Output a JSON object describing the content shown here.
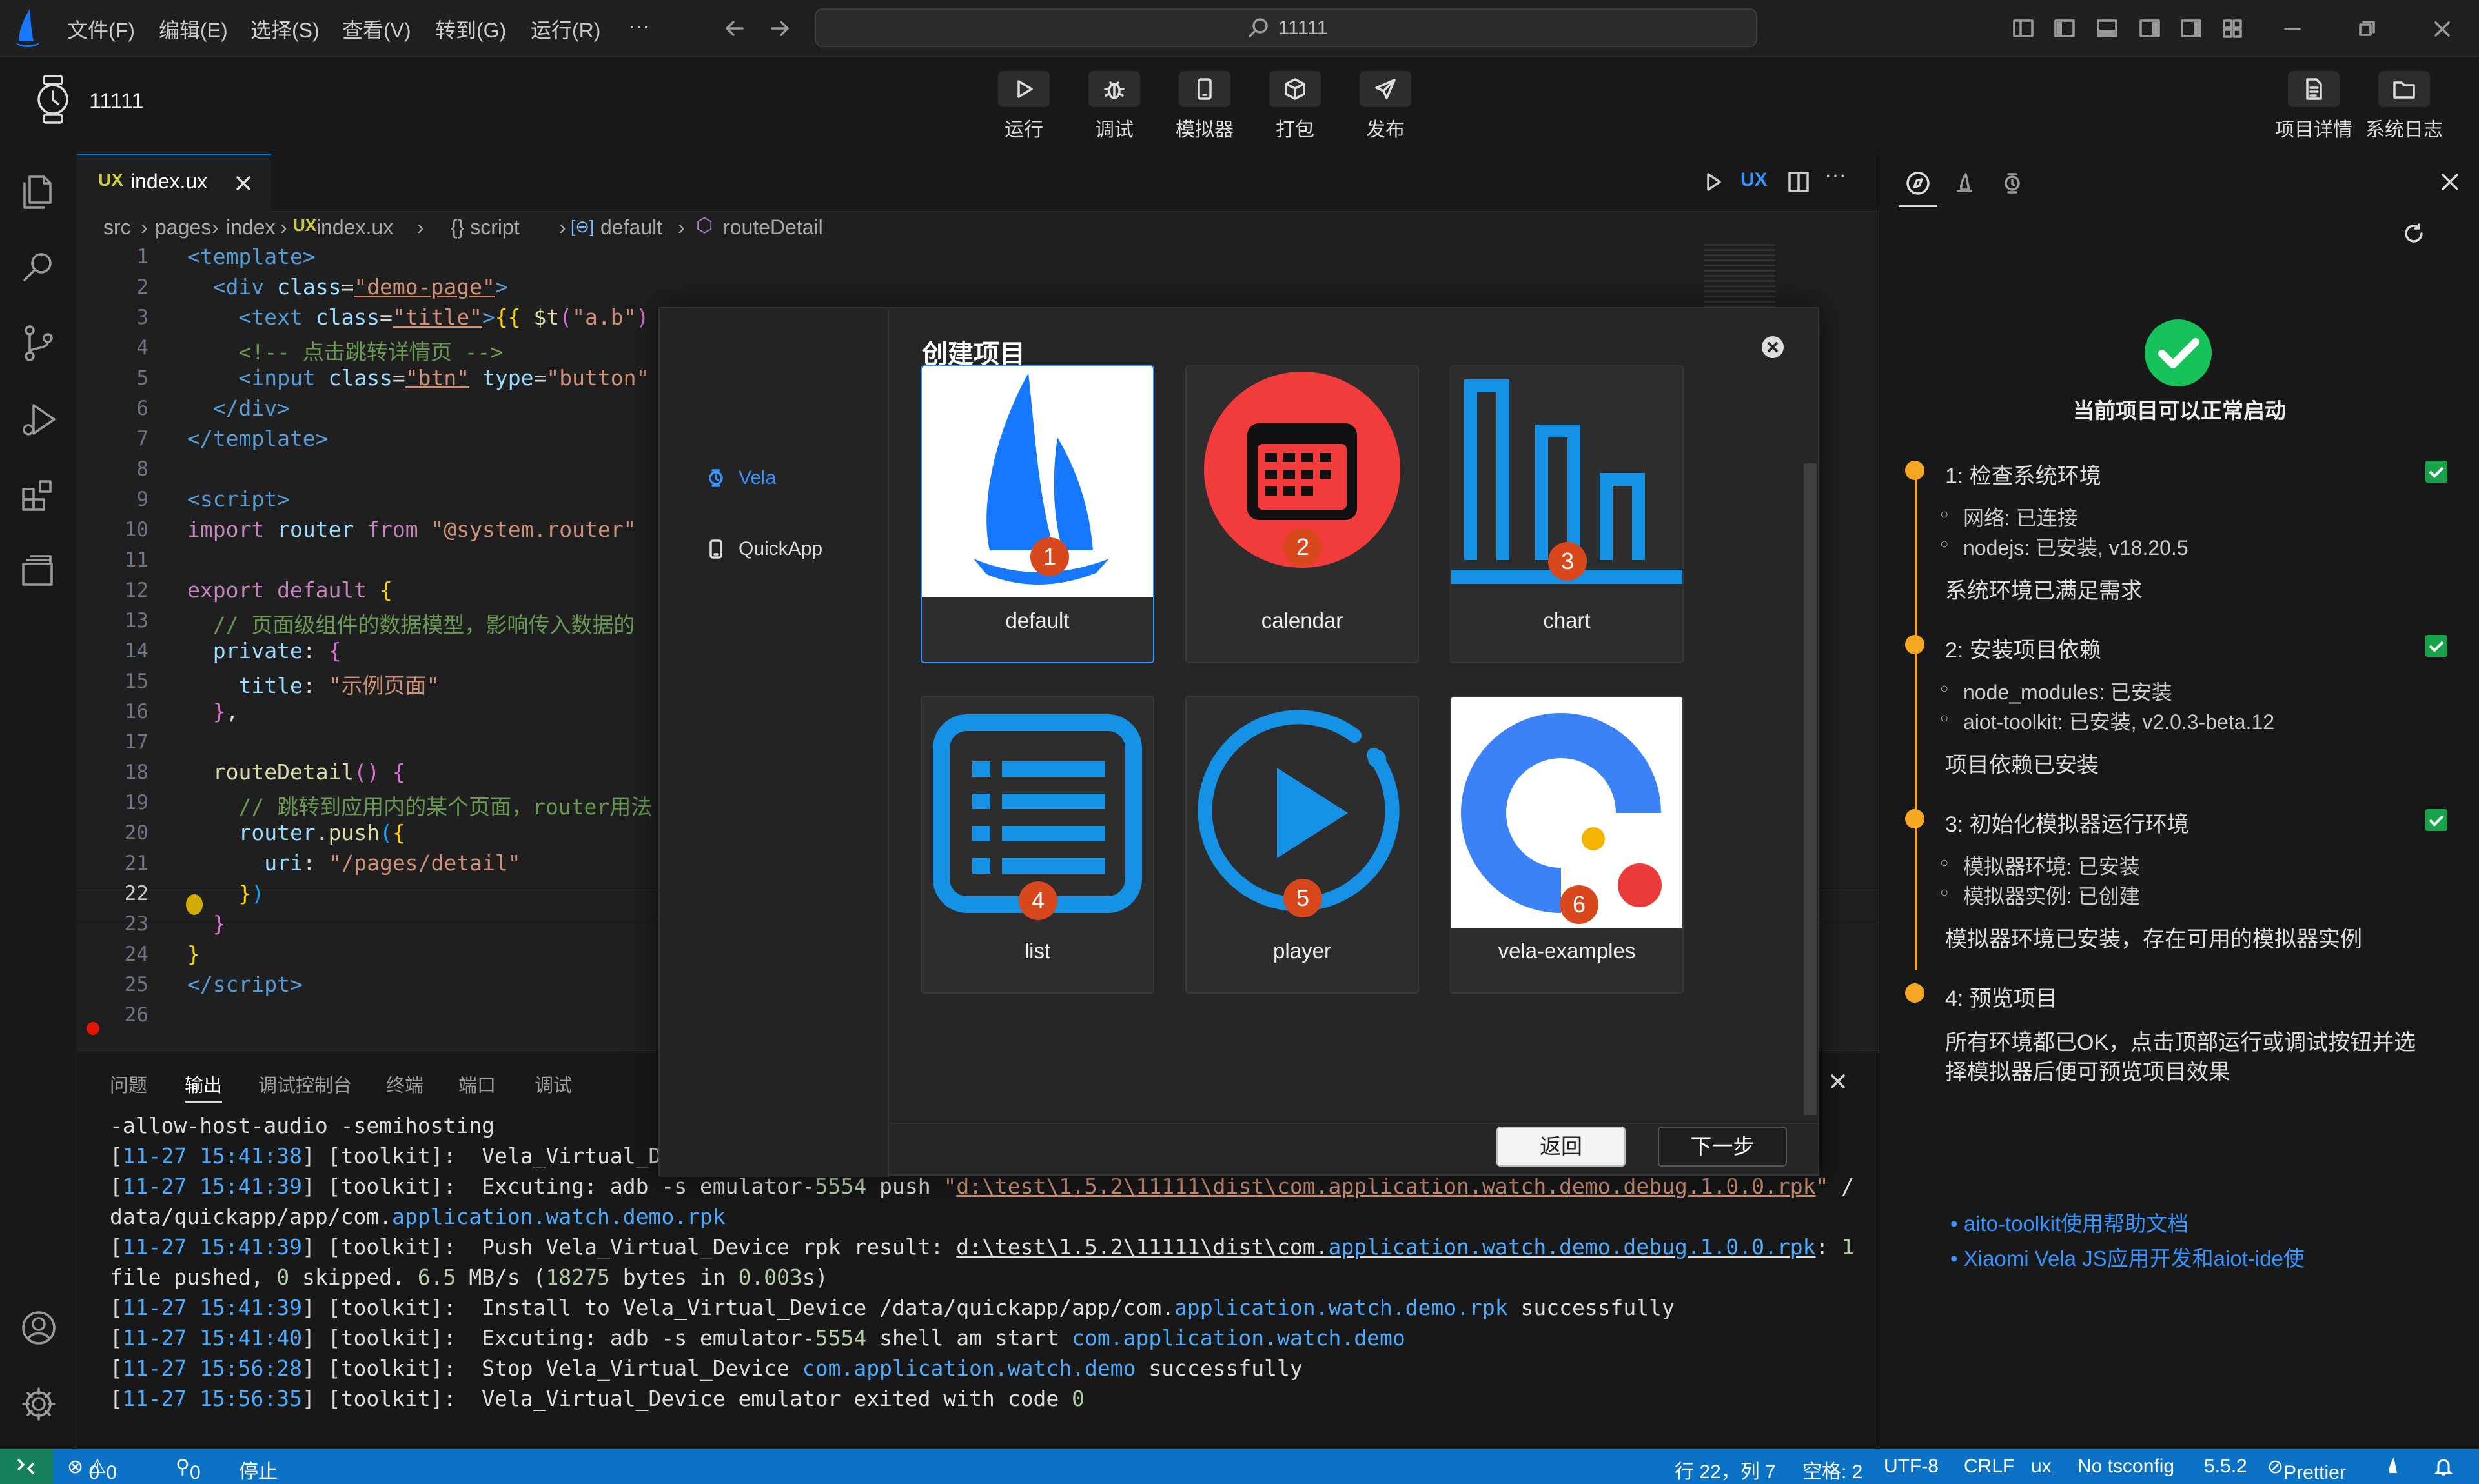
{
  "menubar": {
    "menus": [
      "文件(F)",
      "编辑(E)",
      "选择(S)",
      "查看(V)",
      "转到(G)",
      "运行(R)",
      "···"
    ],
    "search_text": "11111"
  },
  "toolbar": {
    "project_name": "11111",
    "actions": [
      "运行",
      "调试",
      "模拟器",
      "打包",
      "发布"
    ],
    "right_actions": [
      "项目详情",
      "系统日志"
    ]
  },
  "editor": {
    "tab_label": "index.ux",
    "tab_badge": "UX",
    "toolbar_badge": "UX",
    "breadcrumb": [
      "src",
      "pages",
      "index",
      "index.ux",
      "{} script",
      "default",
      "routeDetail"
    ],
    "line_numbers": [
      "1",
      "2",
      "3",
      "4",
      "5",
      "6",
      "7",
      "8",
      "9",
      "10",
      "11",
      "12",
      "13",
      "14",
      "15",
      "16",
      "17",
      "18",
      "19",
      "20",
      "21",
      "22",
      "23",
      "24",
      "25",
      "26"
    ],
    "current_line": "22"
  },
  "panel": {
    "tabs": [
      "问题",
      "输出",
      "调试控制台",
      "终端",
      "端口",
      "调试"
    ],
    "active_tab": "输出"
  },
  "dialog": {
    "title": "创建项目",
    "nav": [
      "Vela",
      "QuickApp"
    ],
    "cards": [
      {
        "name": "default",
        "badge": "1"
      },
      {
        "name": "calendar",
        "badge": "2"
      },
      {
        "name": "chart",
        "badge": "3"
      },
      {
        "name": "list",
        "badge": "4"
      },
      {
        "name": "player",
        "badge": "5"
      },
      {
        "name": "vela-examples",
        "badge": "6"
      }
    ],
    "back_label": "返回",
    "next_label": "下一步"
  },
  "side": {
    "status_title": "当前项目可以正常启动",
    "steps": [
      {
        "title": "1: 检查系统环境",
        "items": [
          "网络: 已连接",
          "nodejs: 已安装, v18.20.5"
        ],
        "summary": "系统环境已满足需求"
      },
      {
        "title": "2: 安装项目依赖",
        "items": [
          "node_modules: 已安装",
          "aiot-toolkit: 已安装, v2.0.3-beta.12"
        ],
        "summary": "项目依赖已安装"
      },
      {
        "title": "3: 初始化模拟器运行环境",
        "items": [
          "模拟器环境: 已安装",
          "模拟器实例: 已创建"
        ],
        "summary": "模拟器环境已安装，存在可用的模拟器实例"
      },
      {
        "title": "4: 预览项目",
        "items": [],
        "summary_lines": [
          "所有环境都已OK，点击顶部运行或调试按钮并选",
          "择模拟器后便可预览项目效果"
        ]
      }
    ],
    "links": [
      "aito-toolkit使用帮助文档",
      "Xiaomi Vela JS应用开发和aiot-ide使"
    ]
  },
  "statusbar": {
    "errors": "0",
    "warnings": "0",
    "ports": "0",
    "stop": "停止",
    "position": "行 22，列 7",
    "spaces": "空格: 2",
    "encoding": "UTF-8",
    "eol": "CRLF",
    "language": "ux",
    "tsconfig": "No tsconfig",
    "version": "5.5.2",
    "prettier": "Prettier"
  },
  "colors": {
    "accent": "#0078d4",
    "status_bar": "#0b72c5",
    "step_dot": "#f5a623",
    "check": "#16a34a",
    "badge": "#d9481c"
  }
}
